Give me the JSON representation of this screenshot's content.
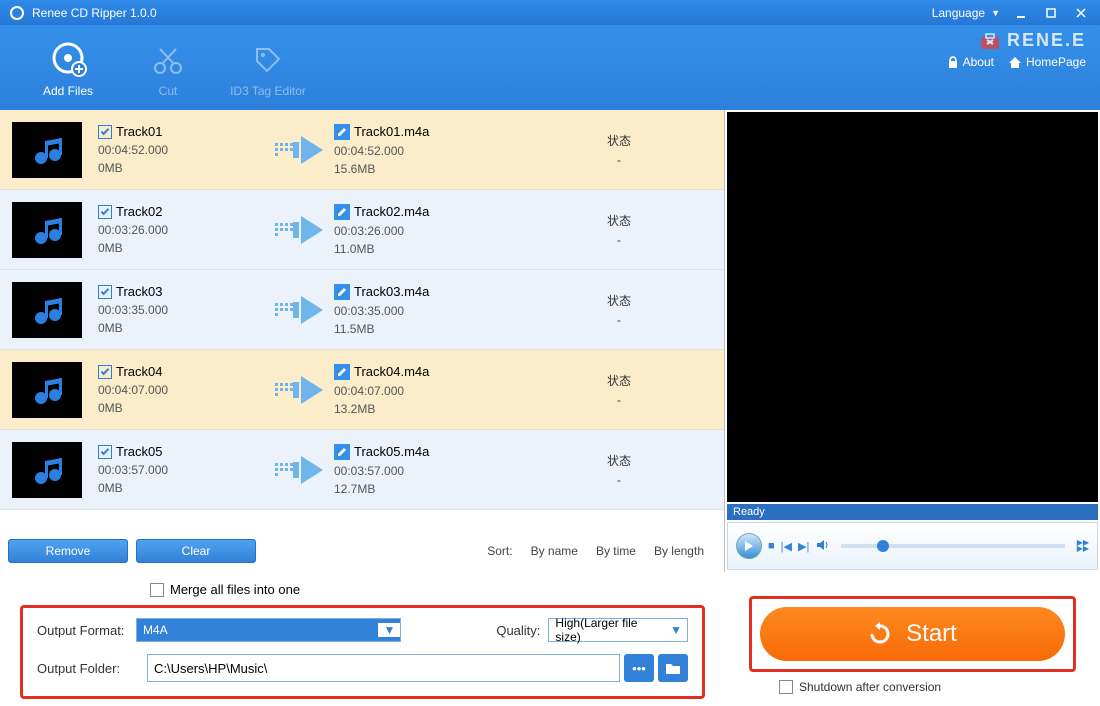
{
  "titlebar": {
    "title": "Renee CD Ripper 1.0.0",
    "language": "Language"
  },
  "brand": {
    "name": "RENE.E",
    "about": "About",
    "home": "HomePage"
  },
  "toolbar": {
    "add": "Add Files",
    "cut": "Cut",
    "tag": "ID3 Tag Editor"
  },
  "tracks": [
    {
      "name": "Track01",
      "dur": "00:04:52.000",
      "size": "0MB",
      "out": "Track01.m4a",
      "outdur": "00:04:52.000",
      "outsize": "15.6MB",
      "status": "状态",
      "dash": "-",
      "alt": true
    },
    {
      "name": "Track02",
      "dur": "00:03:26.000",
      "size": "0MB",
      "out": "Track02.m4a",
      "outdur": "00:03:26.000",
      "outsize": "11.0MB",
      "status": "状态",
      "dash": "-",
      "alt": false
    },
    {
      "name": "Track03",
      "dur": "00:03:35.000",
      "size": "0MB",
      "out": "Track03.m4a",
      "outdur": "00:03:35.000",
      "outsize": "11.5MB",
      "status": "状态",
      "dash": "-",
      "alt": false
    },
    {
      "name": "Track04",
      "dur": "00:04:07.000",
      "size": "0MB",
      "out": "Track04.m4a",
      "outdur": "00:04:07.000",
      "outsize": "13.2MB",
      "status": "状态",
      "dash": "-",
      "alt": true
    },
    {
      "name": "Track05",
      "dur": "00:03:57.000",
      "size": "0MB",
      "out": "Track05.m4a",
      "outdur": "00:03:57.000",
      "outsize": "12.7MB",
      "status": "状态",
      "dash": "-",
      "alt": false
    }
  ],
  "list_footer": {
    "remove": "Remove",
    "clear": "Clear",
    "sort": "Sort:",
    "byname": "By name",
    "bytime": "By time",
    "bylength": "By length"
  },
  "preview": {
    "ready": "Ready"
  },
  "merge": {
    "label": "Merge all files into one"
  },
  "output": {
    "format_label": "Output Format:",
    "format_value": "M4A",
    "quality_label": "Quality:",
    "quality_value": "High(Larger file size)",
    "folder_label": "Output Folder:",
    "folder_value": "C:\\Users\\HP\\Music\\"
  },
  "start": {
    "label": "Start",
    "shutdown": "Shutdown after conversion"
  }
}
